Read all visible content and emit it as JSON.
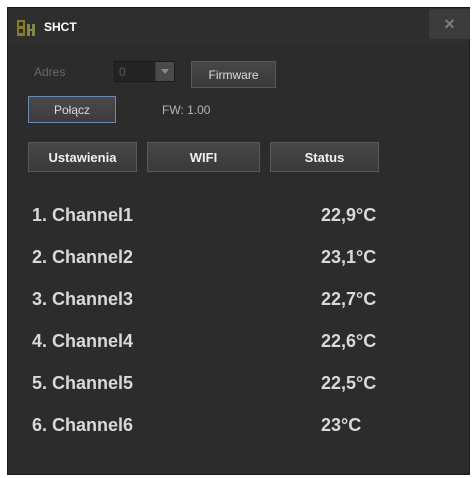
{
  "window": {
    "title": "SHCT",
    "close_label": "×"
  },
  "connection": {
    "adres_label": "Adres",
    "adres_value": "0",
    "firmware_button": "Firmware",
    "connect_button": "Połącz",
    "fw_text": "FW: 1.00"
  },
  "tabs": [
    {
      "label": "Ustawienia"
    },
    {
      "label": "WIFI"
    },
    {
      "label": "Status"
    }
  ],
  "channels": [
    {
      "name": "1. Channel1",
      "temp": "22,9°C"
    },
    {
      "name": "2. Channel2",
      "temp": "23,1°C"
    },
    {
      "name": "3. Channel3",
      "temp": "22,7°C"
    },
    {
      "name": "4. Channel4",
      "temp": "22,6°C"
    },
    {
      "name": "5. Channel5",
      "temp": "22,5°C"
    },
    {
      "name": "6. Channel6",
      "temp": "23°C"
    }
  ],
  "colors": {
    "background": "#2c2c2c",
    "text": "#d9d9d9",
    "accent_border": "#6a8ab3"
  }
}
